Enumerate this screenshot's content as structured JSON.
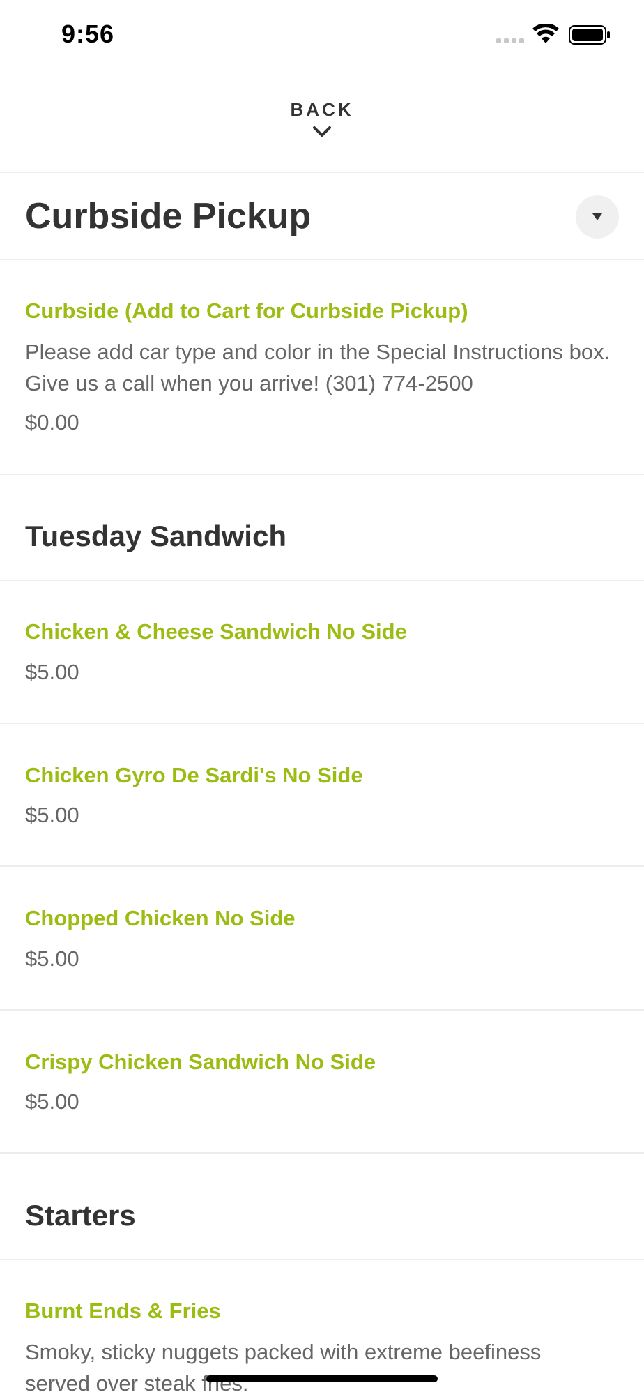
{
  "status_bar": {
    "time": "9:56"
  },
  "header": {
    "back_label": "BACK"
  },
  "category": {
    "title": "Curbside Pickup"
  },
  "items": [
    {
      "name": "Curbside (Add to Cart for Curbside Pickup)",
      "description": "Please add car type and color in the Special Instructions box. Give us a call when you arrive! (301) 774-2500",
      "price": "$0.00"
    }
  ],
  "groups": [
    {
      "title": "Tuesday Sandwich",
      "items": [
        {
          "name": "Chicken & Cheese Sandwich No Side",
          "price": "$5.00"
        },
        {
          "name": "Chicken Gyro De Sardi's No Side",
          "price": "$5.00"
        },
        {
          "name": "Chopped Chicken No Side",
          "price": "$5.00"
        },
        {
          "name": "Crispy Chicken Sandwich No Side",
          "price": "$5.00"
        }
      ]
    },
    {
      "title": "Starters",
      "items": [
        {
          "name": "Burnt Ends & Fries",
          "description": "Smoky, sticky nuggets packed with extreme beefiness served over steak fries."
        }
      ]
    }
  ],
  "colors": {
    "accent": "#9bbc13",
    "text": "#333333",
    "muted": "#666666",
    "divider": "#ececec"
  },
  "icons": {
    "signal": "cellular-signal-icon",
    "wifi": "wifi-icon",
    "battery": "battery-icon",
    "back": "chevron-down-icon",
    "dropdown": "caret-down-icon"
  }
}
